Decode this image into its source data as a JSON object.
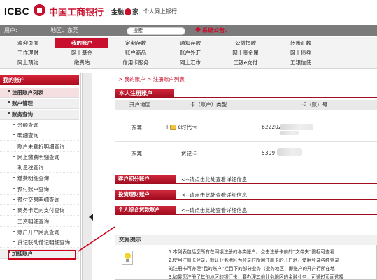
{
  "header": {
    "logo_text": "ICBC",
    "bank_name": "中国工商银行",
    "brand_left": "金融",
    "brand_right": "家",
    "site_name": "个人网上银行"
  },
  "userbar": {
    "user_label": "用户:",
    "region_label": "地区：东莞",
    "search_placeholder": "搜索",
    "announce": "系统公告："
  },
  "nav": {
    "rows": [
      [
        "欢迎页面",
        "我的账户",
        "定期存款",
        "通知存款",
        "公益捐款",
        "转账汇款"
      ],
      [
        "工作理财",
        "网上基金",
        "账户商品",
        "账户外汇",
        "网上贵金属",
        "网上债券"
      ],
      [
        "网上预约",
        "缴费站",
        "信用卡服务",
        "网上汇市",
        "工银e支付",
        "工银信使"
      ]
    ],
    "active": "我的账户"
  },
  "sidebar": {
    "title": "我的账户",
    "items": [
      {
        "label": "注册账户列表",
        "type": "sec",
        "hl": true
      },
      {
        "label": "账户管理",
        "type": "sec"
      },
      {
        "label": "账务查询",
        "type": "sec"
      },
      {
        "label": "余额查询",
        "type": "sub"
      },
      {
        "label": "明细查询",
        "type": "sub"
      },
      {
        "label": "账户未登折明细查询",
        "type": "sub"
      },
      {
        "label": "网上缴费明细查询",
        "type": "sub"
      },
      {
        "label": "利息税查询",
        "type": "sub"
      },
      {
        "label": "缴费明细查询",
        "type": "sub"
      },
      {
        "label": "预付账户查询",
        "type": "sub"
      },
      {
        "label": "预付交易明细查询",
        "type": "sub"
      },
      {
        "label": "商务卡定向支付查询",
        "type": "sub"
      },
      {
        "label": "工资明细查询",
        "type": "sub"
      },
      {
        "label": "账户开户网点查询",
        "type": "sub"
      },
      {
        "label": "贷记联动借记明细查询",
        "type": "sub"
      },
      {
        "label": "加挂账户",
        "type": "sec"
      }
    ]
  },
  "breadcrumb": {
    "home": "我的账户",
    "sep": " > ",
    "current": "注册账户列表"
  },
  "panel": {
    "title": "本人注册账户",
    "columns": [
      "开户地区",
      "卡（账户）类型",
      "卡（账）号"
    ],
    "rows": [
      {
        "region": "东莞",
        "type": "e时代卡",
        "number": "622202"
      },
      {
        "region": "东莞",
        "type": "贷记卡",
        "number": "5309"
      }
    ]
  },
  "account_groups": [
    {
      "label": "客户积分账户",
      "hint": "<--请点击此处查看详细信息"
    },
    {
      "label": "投资理财账户",
      "hint": "<--请点击此处查看详细信息"
    },
    {
      "label": "个人综合贷款账户",
      "hint": "<--请点击此处查看详细信息"
    }
  ],
  "tips": {
    "title": "交易提示",
    "lines": [
      "1.本列表包括您所有在网银注册的各类账户。点击注册卡前的“文件夹”图标可查看",
      "2.使用注册卡登录，默认业务地区为登录时所用注册卡的开户地，使用登录名称登录",
      "的注册卡可办理“我的账户”栏目下的部分业务（业务地区：即账户的开户行所在地",
      "3.如果您注册了其他地区的银行卡，要办理其他业务地区的金融业务，可通过页面选择"
    ]
  },
  "colors": {
    "brand_red": "#c8102e",
    "annotation_red": "#d0021b"
  }
}
